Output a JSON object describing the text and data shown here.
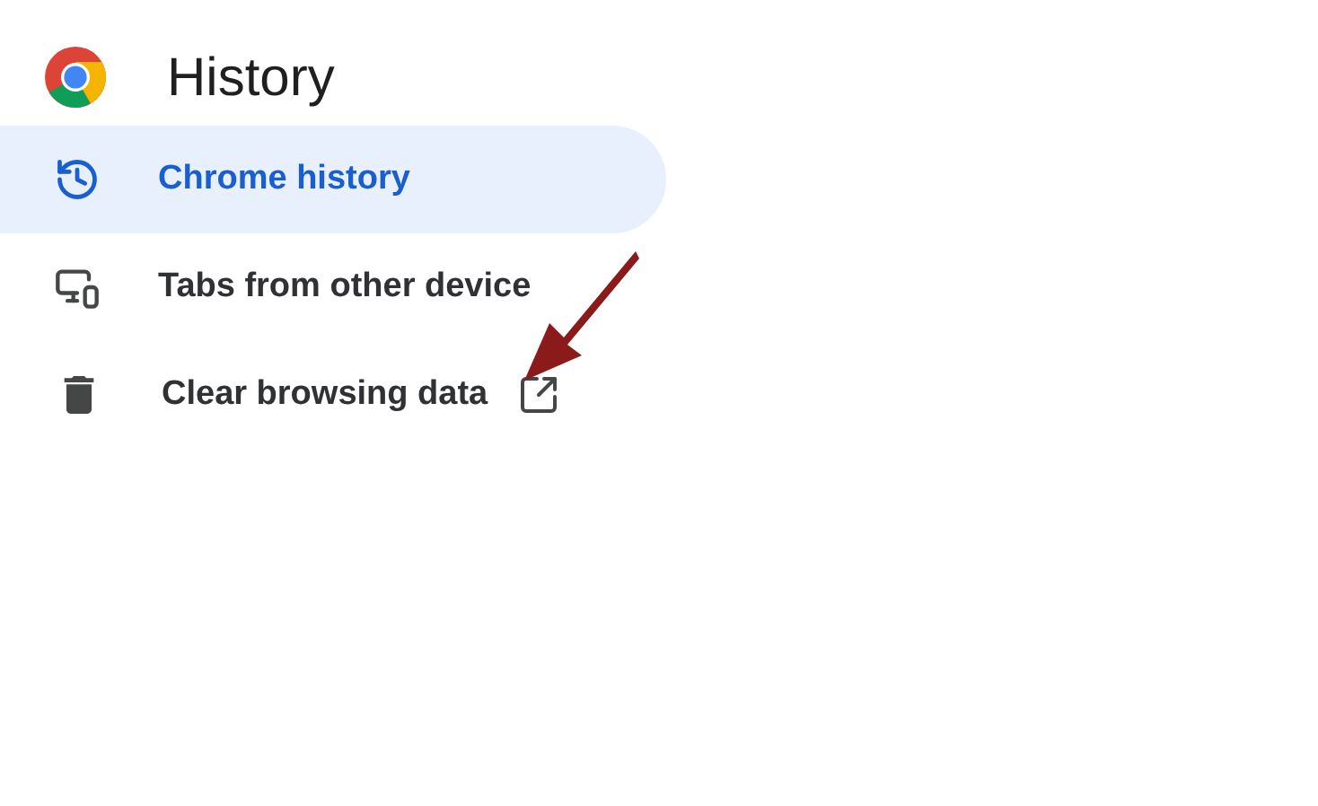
{
  "header": {
    "title": "History"
  },
  "nav": [
    {
      "kind": "history",
      "label": "Chrome history",
      "selected": true,
      "external": false
    },
    {
      "kind": "devices",
      "label": "Tabs from other device",
      "selected": false,
      "external": false
    },
    {
      "kind": "clear",
      "label": "Clear browsing data",
      "selected": false,
      "external": true
    }
  ]
}
